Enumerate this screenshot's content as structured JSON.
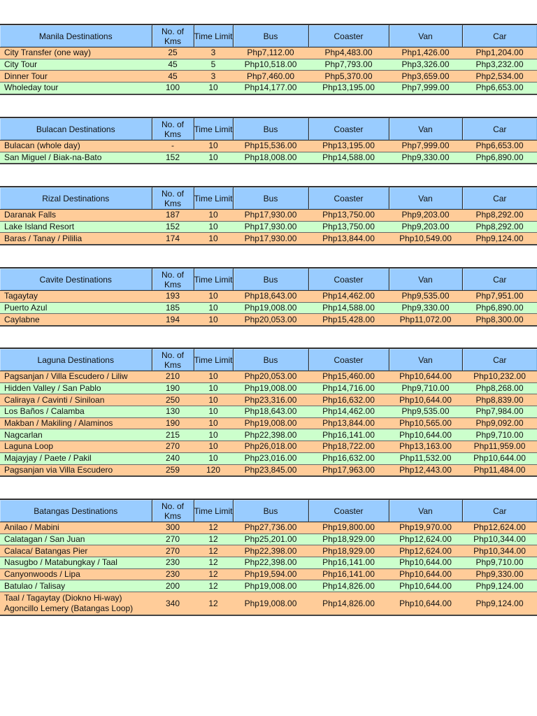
{
  "columns": [
    "No. of Kms",
    "Time Limit",
    "Bus",
    "Coaster",
    "Van",
    "Car"
  ],
  "colors": {
    "header": "#99ccff",
    "row_odd": "#ffcc99",
    "row_even": "#ccffcc"
  },
  "tables": [
    {
      "title": "Manila Destinations",
      "rows": [
        [
          "City Transfer (one way)",
          "25",
          "3",
          "Php7,112.00",
          "Php4,483.00",
          "Php1,426.00",
          "Php1,204.00"
        ],
        [
          "City Tour",
          "45",
          "5",
          "Php10,518.00",
          "Php7,793.00",
          "Php3,326.00",
          "Php3,232.00"
        ],
        [
          "Dinner Tour",
          "45",
          "3",
          "Php7,460.00",
          "Php5,370.00",
          "Php3,659.00",
          "Php2,534.00"
        ],
        [
          "Wholeday tour",
          "100",
          "10",
          "Php14,177.00",
          "Php13,195.00",
          "Php7,999.00",
          "Php6,653.00"
        ]
      ]
    },
    {
      "title": "Bulacan Destinations",
      "rows": [
        [
          "Bulacan (whole day)",
          "-",
          "10",
          "Php15,536.00",
          "Php13,195.00",
          "Php7,999.00",
          "Php6,653.00"
        ],
        [
          "San Miguel / Biak-na-Bato",
          "152",
          "10",
          "Php18,008.00",
          "Php14,588.00",
          "Php9,330.00",
          "Php6,890.00"
        ]
      ]
    },
    {
      "title": "Rizal Destinations",
      "rows": [
        [
          "Daranak Falls",
          "187",
          "10",
          "Php17,930.00",
          "Php13,750.00",
          "Php9,203.00",
          "Php8,292.00"
        ],
        [
          "Lake Island Resort",
          "152",
          "10",
          "Php17,930.00",
          "Php13,750.00",
          "Php9,203.00",
          "Php8,292.00"
        ],
        [
          "Baras / Tanay / Pililia",
          "174",
          "10",
          "Php17,930.00",
          "Php13,844.00",
          "Php10,549.00",
          "Php9,124.00"
        ]
      ]
    },
    {
      "title": "Cavite Destinations",
      "rows": [
        [
          "Tagaytay",
          "193",
          "10",
          "Php18,643.00",
          "Php14,462.00",
          "Php9,535.00",
          "Php7,951.00"
        ],
        [
          "Puerto Azul",
          "185",
          "10",
          "Php19,008.00",
          "Php14,588.00",
          "Php9,330.00",
          "Php6,890.00"
        ],
        [
          "Caylabne",
          "194",
          "10",
          "Php20,053.00",
          "Php15,428.00",
          "Php11,072.00",
          "Php8,300.00"
        ]
      ]
    },
    {
      "title": "Laguna Destinations",
      "rows": [
        [
          "Pagsanjan / Villa Escudero / Liliw",
          "210",
          "10",
          "Php20,053.00",
          "Php15,460.00",
          "Php10,644.00",
          "Php10,232.00"
        ],
        [
          "Hidden Valley / San Pablo",
          "190",
          "10",
          "Php19,008.00",
          "Php14,716.00",
          "Php9,710.00",
          "Php8,268.00"
        ],
        [
          "Caliraya / Cavinti / Siniloan",
          "250",
          "10",
          "Php23,316.00",
          "Php16,632.00",
          "Php10,644.00",
          "Php8,839.00"
        ],
        [
          "Los Baños / Calamba",
          "130",
          "10",
          "Php18,643.00",
          "Php14,462.00",
          "Php9,535.00",
          "Php7,984.00"
        ],
        [
          "Makban / Makiling / Alaminos",
          "190",
          "10",
          "Php19,008.00",
          "Php13,844.00",
          "Php10,565.00",
          "Php9,092.00"
        ],
        [
          "Nagcarlan",
          "215",
          "10",
          "Php22,398.00",
          "Php16,141.00",
          "Php10,644.00",
          "Php9,710.00"
        ],
        [
          "Laguna Loop",
          "270",
          "10",
          "Php26,018.00",
          "Php18,722.00",
          "Php13,163.00",
          "Php11,959.00"
        ],
        [
          "Majayjay / Paete / Pakil",
          "240",
          "10",
          "Php23,016.00",
          "Php16,632.00",
          "Php11,532.00",
          "Php10,644.00"
        ],
        [
          "Pagsanjan via Villa Escudero",
          "259",
          "120",
          "Php23,845.00",
          "Php17,963.00",
          "Php12,443.00",
          "Php11,484.00"
        ]
      ]
    },
    {
      "title": "Batangas Destinations",
      "rows": [
        [
          "Anilao / Mabini",
          "300",
          "12",
          "Php27,736.00",
          "Php19,800.00",
          "Php19,970.00",
          "Php12,624.00"
        ],
        [
          "Calatagan / San Juan",
          "270",
          "12",
          "Php25,201.00",
          "Php18,929.00",
          "Php12,624.00",
          "Php10,344.00"
        ],
        [
          "Calaca/ Batangas Pier",
          "270",
          "12",
          "Php22,398.00",
          "Php18,929.00",
          "Php12,624.00",
          "Php10,344.00"
        ],
        [
          "Nasugbo / Matabungkay / Taal",
          "230",
          "12",
          "Php22,398.00",
          "Php16,141.00",
          "Php10,644.00",
          "Php9,710.00"
        ],
        [
          "Canyonwoods / Lipa",
          "230",
          "12",
          "Php19,594.00",
          "Php16,141.00",
          "Php10,644.00",
          "Php9,330.00"
        ],
        [
          "Batulao / Talisay",
          "200",
          "12",
          "Php19,008.00",
          "Php14,826.00",
          "Php10,644.00",
          "Php9,124.00"
        ],
        [
          "Taal / Tagaytay (Diokno Hi-way) Agoncillo Lemery (Batangas Loop)",
          "340",
          "12",
          "Php19,008.00",
          "Php14,826.00",
          "Php10,644.00",
          "Php9,124.00"
        ]
      ]
    }
  ]
}
